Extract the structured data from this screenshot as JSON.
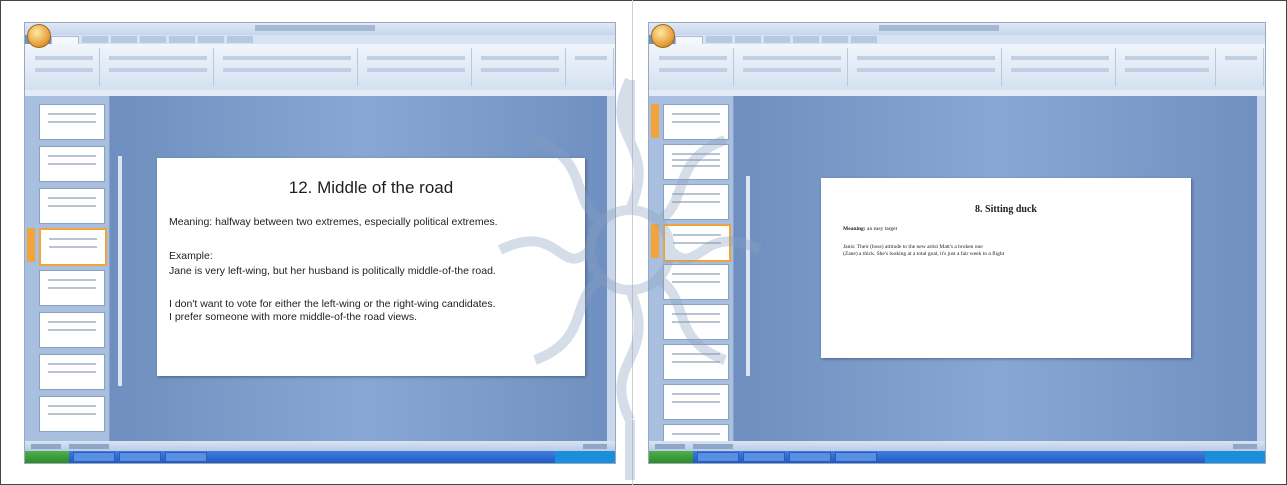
{
  "slideA": {
    "title": "12. Middle of the road",
    "meaning": "Meaning: halfway between two extremes, especially political extremes.",
    "example_label": "Example:",
    "example1": "Jane is very left-wing, but her husband is politically middle-of-the road.",
    "example2_line1": "I don't want to vote for either the left-wing or the right-wing candidates.",
    "example2_line2": "I prefer someone with more middle-of-the road views."
  },
  "slideB": {
    "title": "8. Sitting duck",
    "meaning_label": "Meaning:",
    "meaning_text": "an easy target",
    "example_line1": "Janis: Their (boss) attitude to the new artist Matt's a broken one",
    "example_line2": "(Zane) a thick. She's looking at a total goal, it's just a fair week to a flight"
  },
  "icons": [
    "office-button-icon",
    "watermark-logo-icon",
    "start-button-icon"
  ],
  "colors": {
    "background": "#6f93c4",
    "ribbon": "#d5e1f1",
    "selected_thumb": "#f2a33a",
    "taskbar": "#2458c2"
  }
}
